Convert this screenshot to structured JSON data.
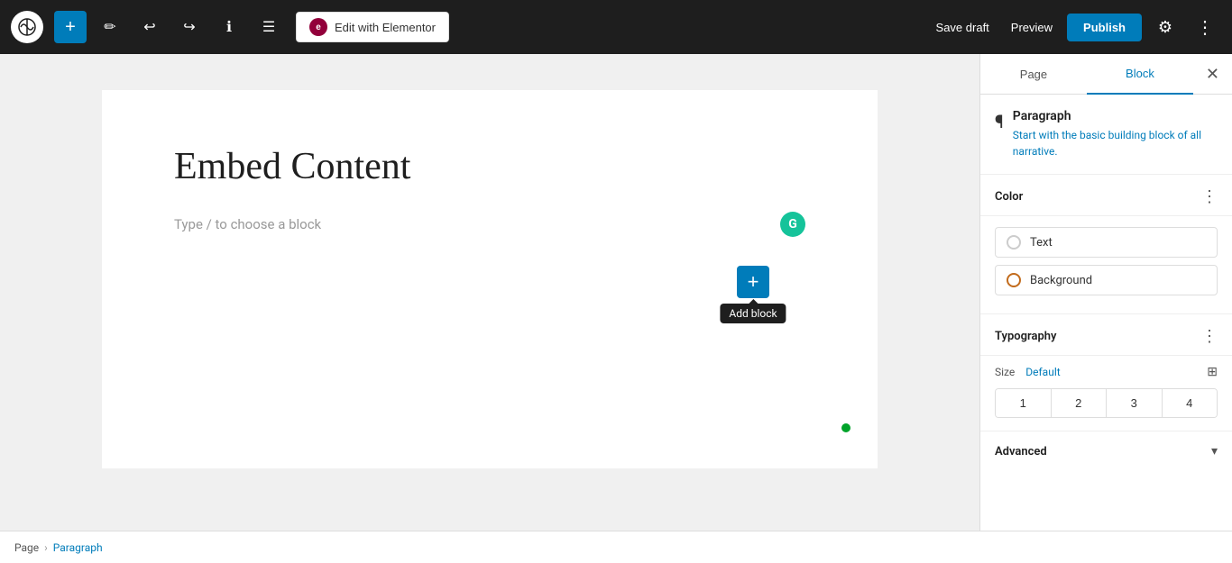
{
  "toolbar": {
    "add_label": "+",
    "edit_elementor_label": "Edit with Elementor",
    "save_draft_label": "Save draft",
    "preview_label": "Preview",
    "publish_label": "Publish"
  },
  "editor": {
    "page_title": "Embed Content",
    "block_placeholder": "Type / to choose a block",
    "add_block_tooltip": "Add block"
  },
  "right_panel": {
    "tab_page": "Page",
    "tab_block": "Block",
    "paragraph_title": "Paragraph",
    "paragraph_description_start": "Start with the basic building block of",
    "paragraph_description_link": "all narrative.",
    "color_section_title": "Color",
    "color_text_label": "Text",
    "color_background_label": "Background",
    "typography_section_title": "Typography",
    "size_label": "Size",
    "size_default": "Default",
    "size_btn_1": "1",
    "size_btn_2": "2",
    "size_btn_3": "3",
    "size_btn_4": "4",
    "advanced_section_title": "Advanced"
  },
  "breadcrumb": {
    "page_label": "Page",
    "separator": "›",
    "current_label": "Paragraph"
  }
}
